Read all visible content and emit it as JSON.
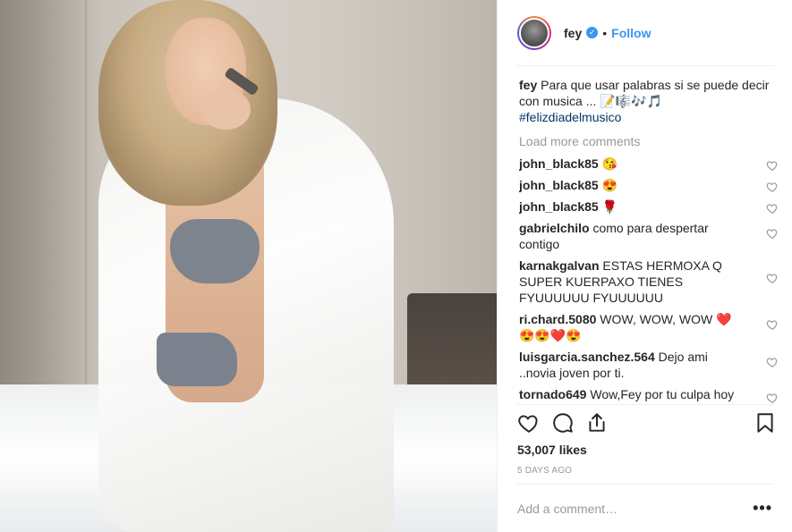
{
  "post": {
    "username": "fey",
    "follow_label": "Follow",
    "separator": "•",
    "verified_glyph": "✓",
    "caption_user": "fey",
    "caption_text": "Para que usar palabras si se puede decir con musica ... 📝🎼🎶🎵",
    "caption_hashtag": "#felizdiadelmusico",
    "load_more_label": "Load more comments",
    "comments": [
      {
        "user": "john_black85",
        "text": "😘"
      },
      {
        "user": "john_black85",
        "text": "😍"
      },
      {
        "user": "john_black85",
        "text": "🌹"
      },
      {
        "user": "gabrielchilo",
        "text": "como para despertar contigo"
      },
      {
        "user": "karnakgalvan",
        "text": "ESTAS HERMOXA Q SUPER KUERPAXO TIENES FYUUUUUU FYUUUUUU"
      },
      {
        "user": "ri.chard.5080",
        "text": "WOW, WOW, WOW ❤️ 😍😍❤️😍"
      },
      {
        "user": "luisgarcia.sanchez.564",
        "text": "Dejo ami ..novia joven por ti."
      },
      {
        "user": "tornado649",
        "text": "Wow,Fey por tu culpa hoy"
      }
    ],
    "likes": "53,007 likes",
    "time": "5 DAYS AGO",
    "add_comment_placeholder": "Add a comment…",
    "more_glyph": "•••"
  },
  "icons": {
    "like": "heart-icon",
    "comment": "comment-icon",
    "share": "share-icon",
    "save": "bookmark-icon",
    "comment_like": "heart-icon"
  },
  "colors": {
    "accent": "#3897f0",
    "text": "#262626",
    "muted": "#999999",
    "hashtag": "#003569"
  }
}
